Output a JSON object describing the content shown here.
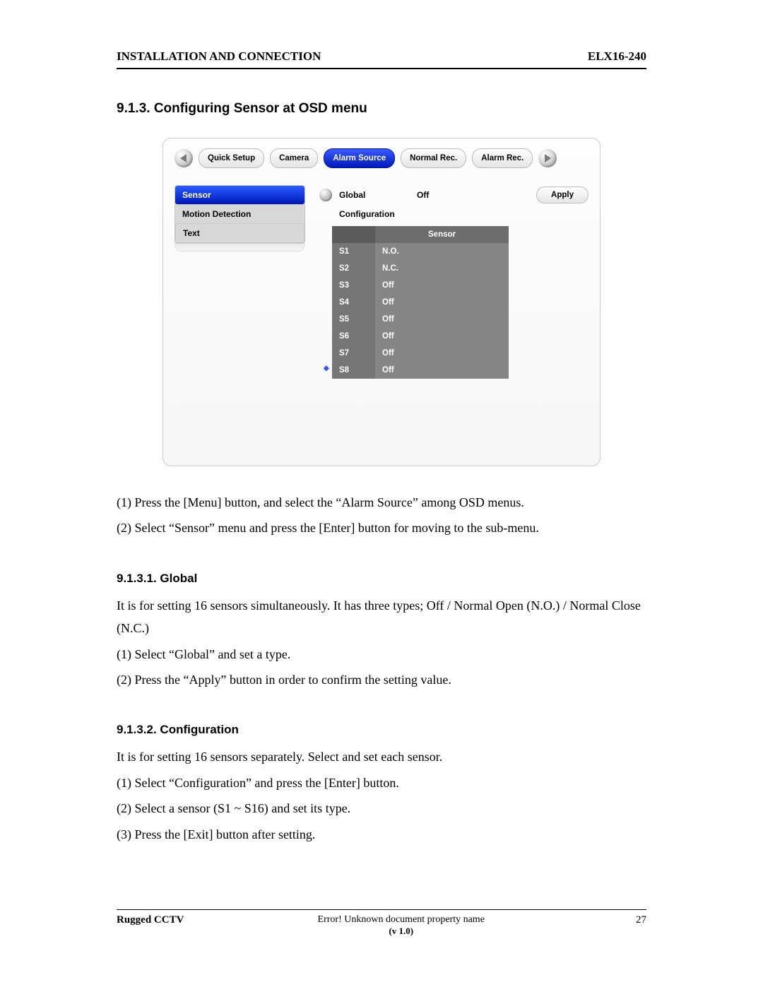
{
  "header": {
    "left": "INSTALLATION AND CONNECTION",
    "right": "ELX16-240"
  },
  "section_title": "9.1.3.   Configuring Sensor at OSD menu",
  "osd": {
    "tabs": [
      "Quick Setup",
      "Camera",
      "Alarm Source",
      "Normal Rec.",
      "Alarm Rec."
    ],
    "active_tab_index": 2,
    "side_items": [
      "Sensor",
      "Motion Detection",
      "Text"
    ],
    "side_selected_index": 0,
    "global_label": "Global",
    "global_value": "Off",
    "apply_label": "Apply",
    "config_label": "Configuration",
    "table_header": "Sensor",
    "rows": [
      {
        "id": "S1",
        "val": "N.O."
      },
      {
        "id": "S2",
        "val": "N.C."
      },
      {
        "id": "S3",
        "val": "Off"
      },
      {
        "id": "S4",
        "val": "Off"
      },
      {
        "id": "S5",
        "val": "Off"
      },
      {
        "id": "S6",
        "val": "Off"
      },
      {
        "id": "S7",
        "val": "Off"
      },
      {
        "id": "S8",
        "val": "Off"
      }
    ],
    "marker_row_index": 7
  },
  "instr1": "(1) Press the [Menu] button, and select the “Alarm Source” among OSD menus.",
  "instr2": "(2) Select “Sensor” menu and press the [Enter] button for moving to the sub-menu.",
  "sub1": {
    "h": "9.1.3.1.   Global",
    "p1": "It is for setting 16 sensors simultaneously. It has three types; Off / Normal Open (N.O.) / Normal Close (N.C.)",
    "p2": "(1) Select “Global” and set a type.",
    "p3": "(2) Press the “Apply” button in order to confirm the setting value."
  },
  "sub2": {
    "h": "9.1.3.2.   Configuration",
    "p1": "It is for setting 16 sensors separately. Select and set each sensor.",
    "p2": "(1) Select “Configuration” and press the [Enter] button.",
    "p3": "(2) Select a sensor (S1 ~ S16) and set its type.",
    "p4": "(3) Press the [Exit] button after setting."
  },
  "footer": {
    "left": "Rugged CCTV",
    "center_top": "Error! Unknown document property name",
    "center_bottom": "(v 1.0)",
    "right": "27"
  }
}
